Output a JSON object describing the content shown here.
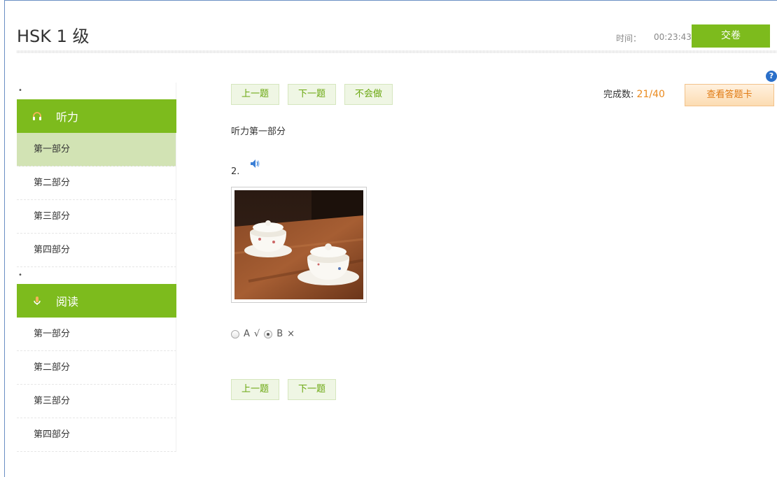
{
  "header": {
    "title": "HSK 1 级",
    "timer_label": "时间：",
    "timer_value": "00:23:43",
    "submit_label": "交卷"
  },
  "sidebar": {
    "sections": [
      {
        "dot": "•",
        "label": "听力",
        "icon": "headphones-icon",
        "items": [
          "第一部分",
          "第二部分",
          "第三部分",
          "第四部分"
        ],
        "active_index": 0
      },
      {
        "dot": "•",
        "label": "阅读",
        "icon": "microphone-icon",
        "items": [
          "第一部分",
          "第二部分",
          "第三部分",
          "第四部分"
        ]
      }
    ]
  },
  "nav": {
    "prev_label": "上一题",
    "next_label": "下一题",
    "skip_label": "不会做"
  },
  "progress": {
    "label": "完成数:",
    "done": "21",
    "sep": "/",
    "total": "40"
  },
  "card_button_label": "查看答题卡",
  "help_label": "?",
  "question": {
    "section_label": "听力第一部分",
    "number": "2.",
    "options": [
      {
        "letter": "A",
        "mark": "√",
        "selected": false
      },
      {
        "letter": "B",
        "mark": "×",
        "selected": true
      }
    ]
  },
  "colors": {
    "accent_green": "#7dbb1d",
    "active_item_bg": "#d2e3b4",
    "orange": "#ea8a1e",
    "help_blue": "#2a6fc9"
  }
}
